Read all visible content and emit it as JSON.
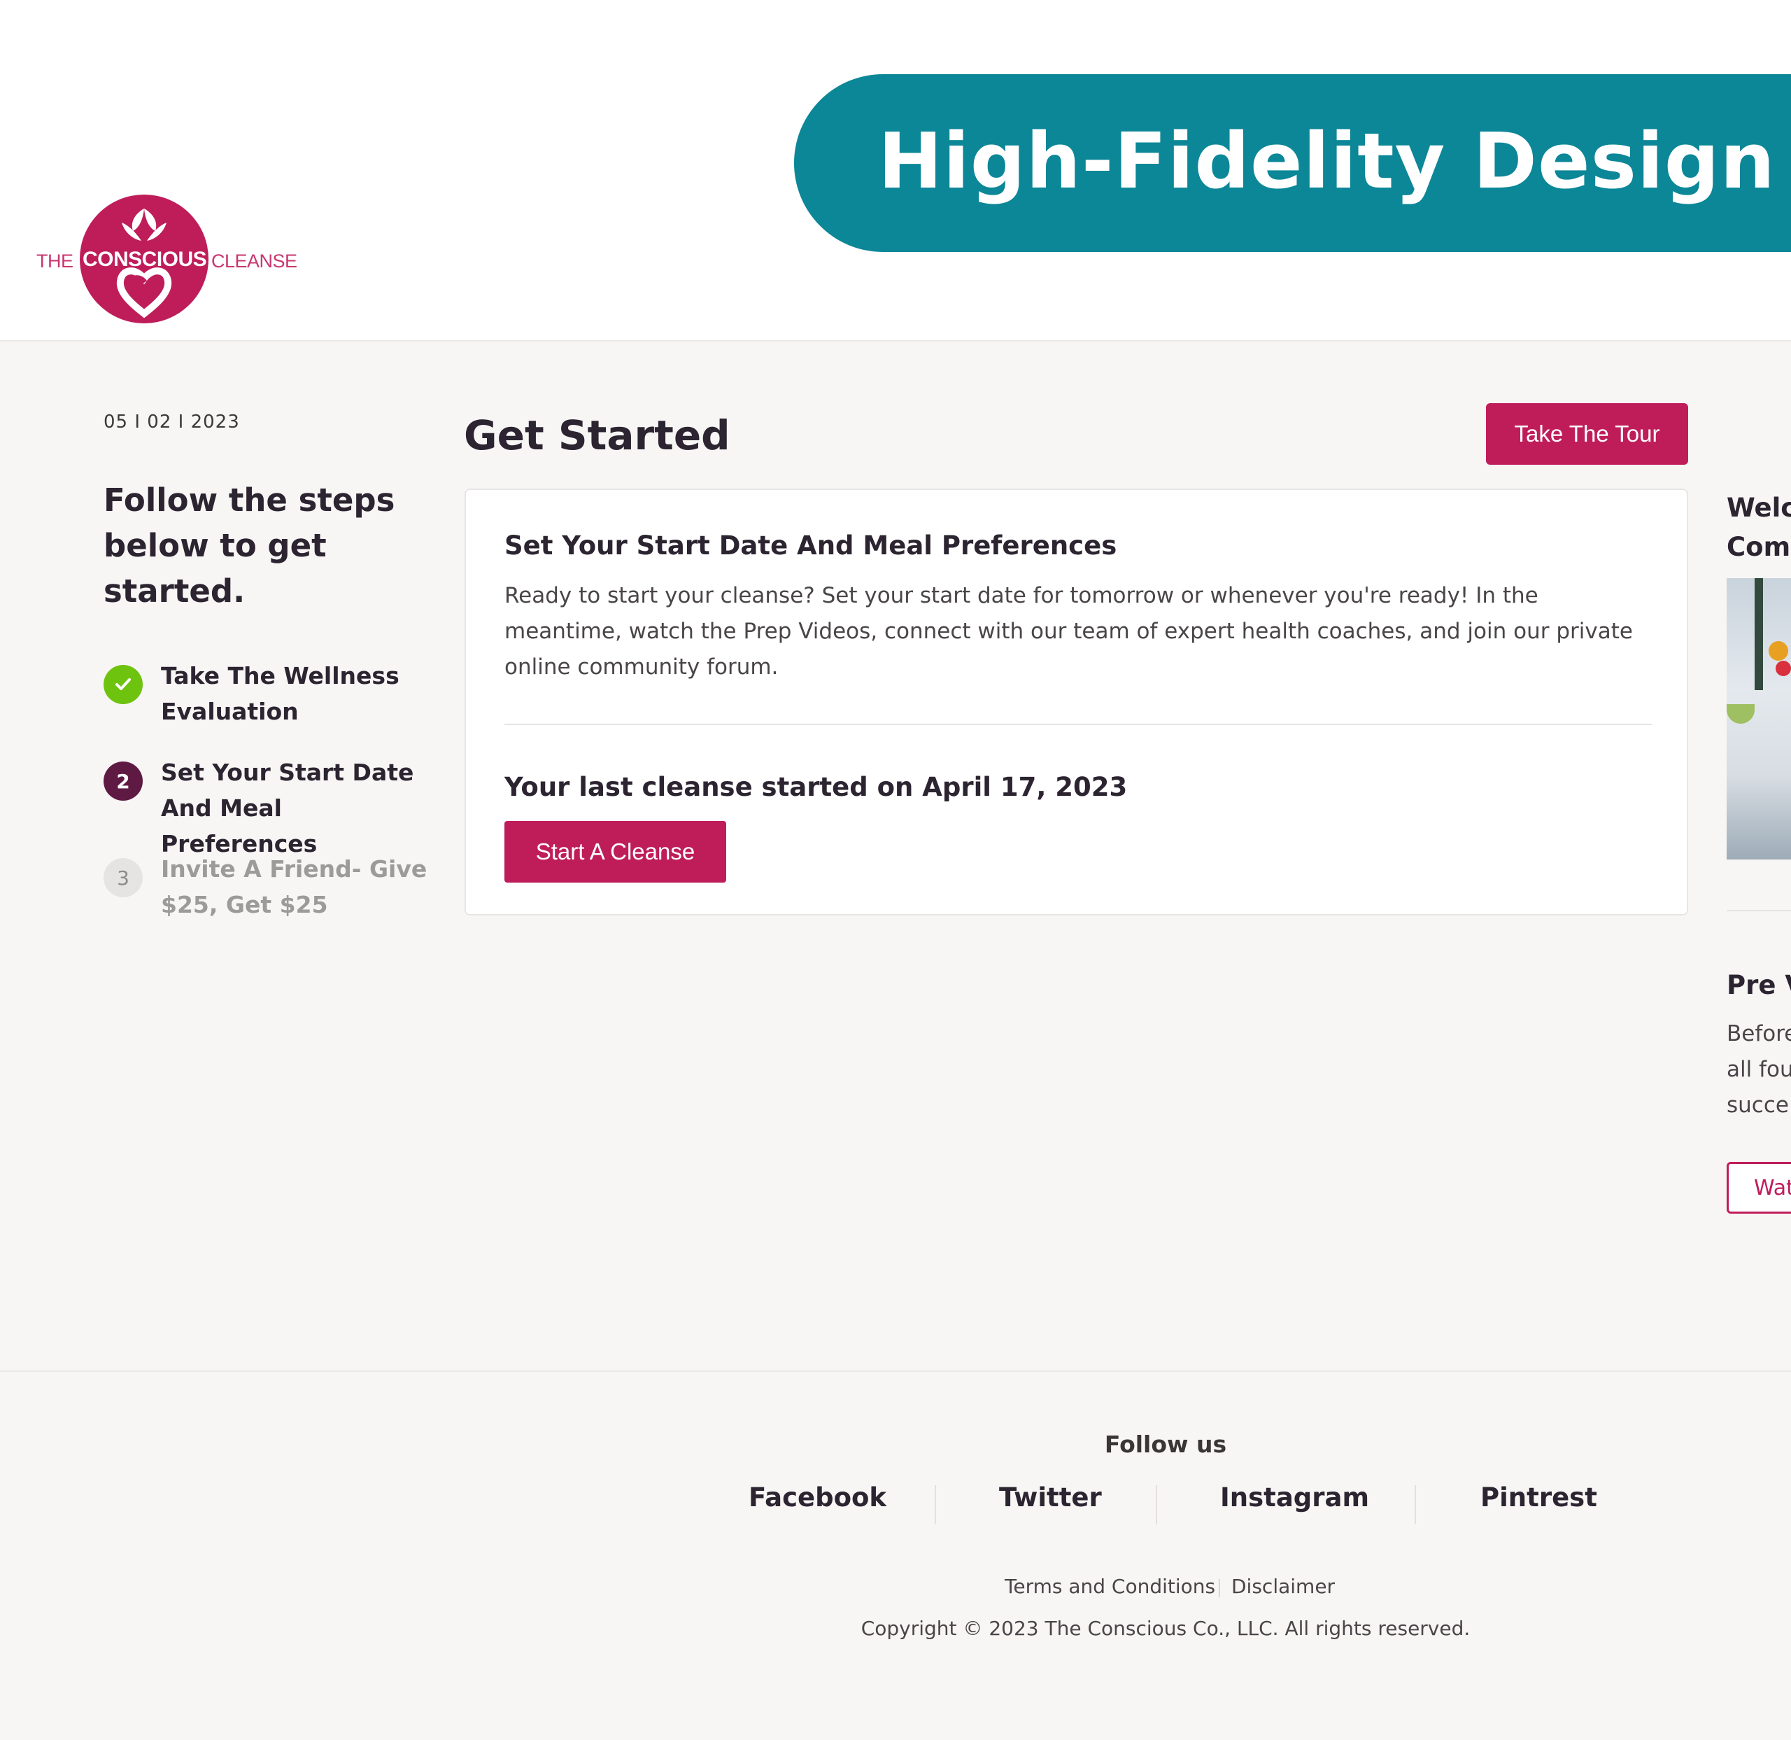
{
  "header": {
    "logo": {
      "left": "THE",
      "middle": "CONSCIOUS",
      "right": "CLEANSE"
    },
    "banner": "High-Fidelity Design"
  },
  "sidebar": {
    "date": "05 I 02 I 2023",
    "title": "Follow the steps below to get started.",
    "steps": [
      {
        "number": "✓",
        "label": "Take The Wellness Evaluation",
        "status": "done"
      },
      {
        "number": "2",
        "label": "Set Your Start Date And Meal Preferences",
        "status": "active"
      },
      {
        "number": "3",
        "label": "Invite A Friend- Give $25, Get $25",
        "status": "pending"
      }
    ]
  },
  "main": {
    "title": "Get Started",
    "tour_button": "Take The Tour",
    "card": {
      "title": "Set Your Start Date And Meal Preferences",
      "description": "Ready to start your cleanse? Set your start date for tomorrow or whenever you're ready! In the meantime, watch the Prep Videos, connect with our team of expert health coaches, and join our private online community forum.",
      "last_cleanse": "Your last cleanse started on April 17, 2023",
      "cta": "Start A Cleanse"
    }
  },
  "right_column": {
    "welcome": "Welc\nComm",
    "pre_title": "Pre V",
    "pre_desc": "Before\nall fou\nsucce",
    "watch_button": "Wat"
  },
  "footer": {
    "follow_label": "Follow us",
    "socials": [
      "Facebook",
      "Twitter",
      "Instagram",
      "Pintrest"
    ],
    "terms": "Terms and Conditions",
    "disclaimer": "Disclaimer",
    "copyright": "Copyright © 2023 The Conscious Co., LLC. All rights reserved."
  },
  "colors": {
    "brand": "#bf1d5a",
    "banner": "#0b8797",
    "step_done": "#6ec30f",
    "step_active": "#5f1a43"
  }
}
